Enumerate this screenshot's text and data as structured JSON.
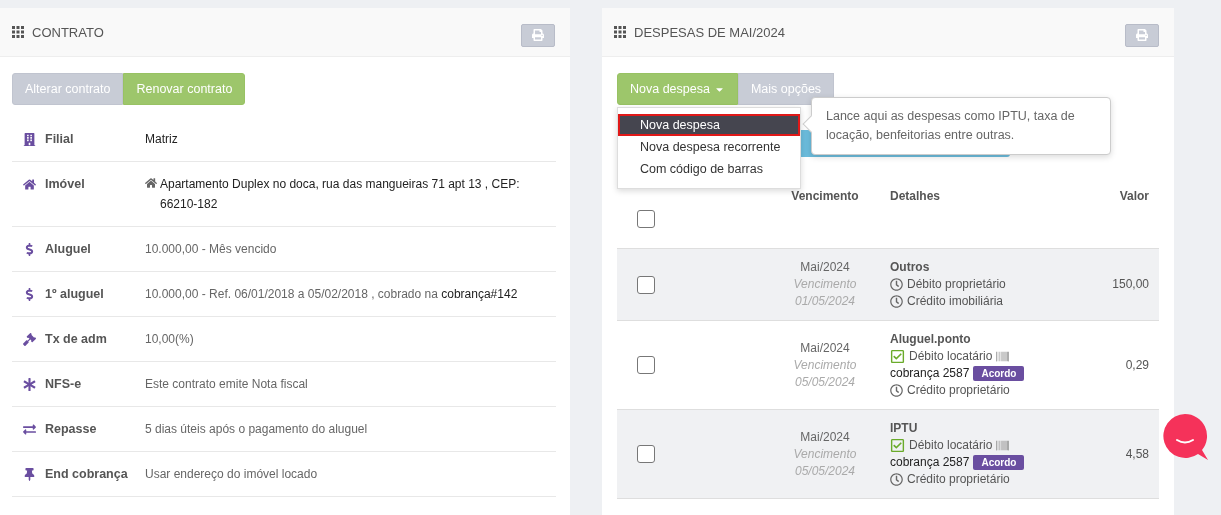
{
  "contract": {
    "title": "CONTRATO",
    "actions": [
      {
        "label": "Alterar contrato",
        "kind": "secondary"
      },
      {
        "label": "Renovar contrato",
        "kind": "success"
      }
    ],
    "fields": [
      {
        "label": "Filial",
        "value": "Matriz"
      },
      {
        "label": "Imóvel",
        "value": "Apartamento Duplex no doca, rua das mangueiras 71 apt 13 , CEP: 66210-182"
      },
      {
        "label": "Aluguel",
        "value": "10.000,00 - Mês vencido"
      },
      {
        "label": "1º aluguel",
        "value": "10.000,00 - Ref. 06/01/2018 a 05/02/2018 , cobrado na",
        "link": "cobrança#142"
      },
      {
        "label": "Tx de adm",
        "value": "10,00(%)"
      },
      {
        "label": "NFS-e",
        "value": "Este contrato emite Nota fiscal"
      },
      {
        "label": "Repasse",
        "value": "5 dias úteis após o pagamento do aluguel"
      },
      {
        "label": "End cobrança",
        "value": "Usar endereço do imóvel locado"
      }
    ]
  },
  "expenses": {
    "title": "DESPESAS DE MAI/2024",
    "new_button": {
      "label": "Nova despesa"
    },
    "more_button": {
      "label": "Mais opções"
    },
    "dropdown": [
      {
        "label": "Nova despesa",
        "selected": true
      },
      {
        "label": "Nova despesa recorrente",
        "selected": false
      },
      {
        "label": "Com código de barras",
        "selected": false
      }
    ],
    "tooltip": "Lance aqui as despesas como IPTU, taxa de locação, benfeitorias entre outras.",
    "columns": [
      "Vencimento",
      "Detalhes",
      "Valor"
    ],
    "select_all": {
      "checked": false
    },
    "rows": [
      {
        "checked": false,
        "month": "Mai/2024",
        "due_label": "Vencimento",
        "due_date": "01/05/2024",
        "category": "Outros",
        "amount": "150,00",
        "lines": [
          {
            "kind": "pending",
            "text": "Débito proprietário"
          },
          {
            "kind": "pending",
            "text": "Crédito imobiliária"
          }
        ]
      },
      {
        "checked": false,
        "month": "Mai/2024",
        "due_label": "Vencimento",
        "due_date": "05/05/2024",
        "category": "Aluguel.ponto",
        "amount": "0,29",
        "lines": [
          {
            "kind": "paid",
            "text": "Débito locatário",
            "barcode": true
          },
          {
            "kind": "billing",
            "text": "cobrança 2587",
            "badge": "Acordo"
          },
          {
            "kind": "pending",
            "text": "Crédito proprietário"
          }
        ]
      },
      {
        "checked": false,
        "month": "Mai/2024",
        "due_label": "Vencimento",
        "due_date": "05/05/2024",
        "category": "IPTU",
        "amount": "4,58",
        "lines": [
          {
            "kind": "paid",
            "text": "Débito locatário",
            "barcode": true
          },
          {
            "kind": "billing",
            "text": "cobrança 2587",
            "badge": "Acordo"
          },
          {
            "kind": "pending",
            "text": "Crédito proprietário"
          }
        ]
      }
    ]
  }
}
